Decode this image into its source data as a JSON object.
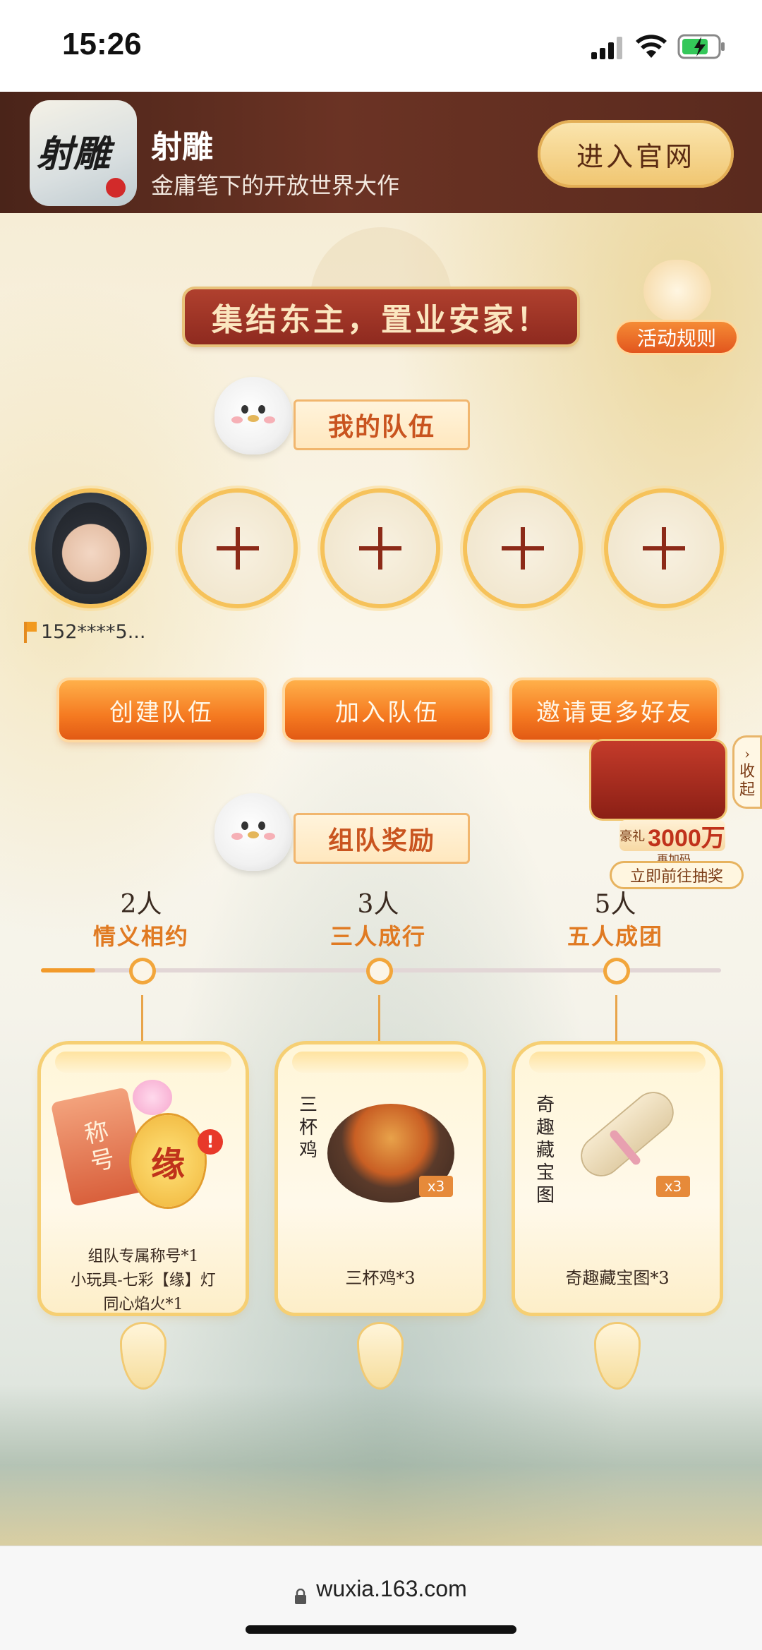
{
  "status_bar": {
    "time": "15:26"
  },
  "app_banner": {
    "icon_text": "射雕",
    "name": "射雕",
    "tagline": "金庸笔下的开放世界大作",
    "official_site_label": "进入官网"
  },
  "event": {
    "title": "集结东主，置业安家！",
    "rules_label": "活动规则"
  },
  "my_team": {
    "section_title": "我的队伍",
    "leader_id": "152****5...",
    "slots_empty": 4
  },
  "actions": {
    "create_team": "创建队伍",
    "join_team": "加入队伍",
    "invite_friends": "邀请更多好友"
  },
  "side_panel": {
    "collapse_label": "收起",
    "gift_prefix": "豪礼",
    "gift_amount": "3000万",
    "gift_sub": "再加码",
    "lottery_label": "立即前往抽奖"
  },
  "team_rewards": {
    "section_title": "组队奖励",
    "progress": 0.08,
    "tiers": [
      {
        "count": "2人",
        "name": "情义相约",
        "item_label": "",
        "description": [
          "组队专属称号*1",
          "小玩具-七彩【缘】灯",
          "同心焰火*1"
        ],
        "qty": ""
      },
      {
        "count": "3人",
        "name": "三人成行",
        "item_label": "三杯鸡",
        "description": [
          "三杯鸡*3"
        ],
        "qty": "x3"
      },
      {
        "count": "5人",
        "name": "五人成团",
        "item_label": "奇趣藏宝图",
        "description": [
          "奇趣藏宝图*3"
        ],
        "qty": "x3"
      }
    ],
    "tier1_art": {
      "tag": "称号",
      "lantern": "缘",
      "alert": "!"
    }
  },
  "browser": {
    "url": "wuxia.163.com"
  },
  "colors": {
    "brand_red": "#8e2a1f",
    "orange": "#f57a21",
    "gold": "#f6c25a"
  }
}
